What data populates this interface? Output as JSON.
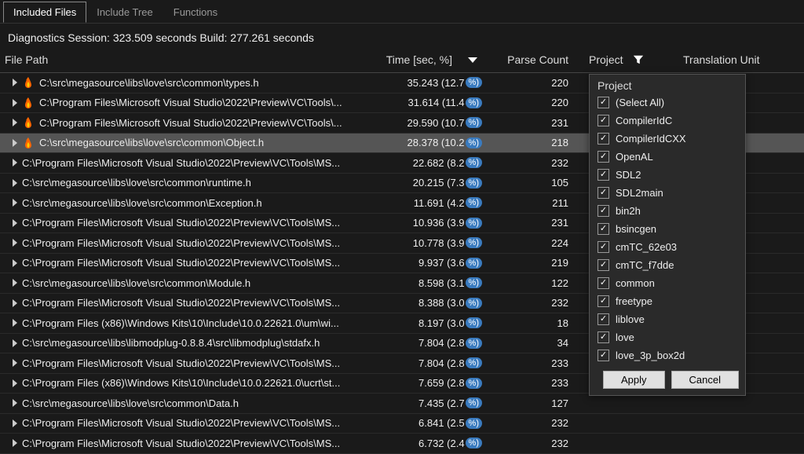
{
  "tabs": {
    "included_files": "Included Files",
    "include_tree": "Include Tree",
    "functions": "Functions"
  },
  "session_info": "Diagnostics Session: 323.509 seconds  Build: 277.261 seconds",
  "columns": {
    "file_path": "File Path",
    "time": "Time [sec, %]",
    "parse_count": "Parse Count",
    "project": "Project",
    "translation_unit": "Translation Unit"
  },
  "rows": [
    {
      "file": "C:\\src\\megasource\\libs\\love\\src\\common\\types.h",
      "time": "35.243 (12.7",
      "pct": "%)",
      "parse": "220",
      "hot": true
    },
    {
      "file": "C:\\Program Files\\Microsoft Visual Studio\\2022\\Preview\\VC\\Tools\\...",
      "time": "31.614 (11.4",
      "pct": "%)",
      "parse": "220",
      "hot": true
    },
    {
      "file": "C:\\Program Files\\Microsoft Visual Studio\\2022\\Preview\\VC\\Tools\\...",
      "time": "29.590 (10.7",
      "pct": "%)",
      "parse": "231",
      "hot": true
    },
    {
      "file": "C:\\src\\megasource\\libs\\love\\src\\common\\Object.h",
      "time": "28.378 (10.2",
      "pct": "%)",
      "parse": "218",
      "hot": true,
      "hover": true
    },
    {
      "file": "C:\\Program Files\\Microsoft Visual Studio\\2022\\Preview\\VC\\Tools\\MS...",
      "time": "22.682 (8.2",
      "pct": "%)",
      "parse": "232"
    },
    {
      "file": "C:\\src\\megasource\\libs\\love\\src\\common\\runtime.h",
      "time": "20.215 (7.3",
      "pct": "%)",
      "parse": "105"
    },
    {
      "file": "C:\\src\\megasource\\libs\\love\\src\\common\\Exception.h",
      "time": "11.691 (4.2",
      "pct": "%)",
      "parse": "211"
    },
    {
      "file": "C:\\Program Files\\Microsoft Visual Studio\\2022\\Preview\\VC\\Tools\\MS...",
      "time": "10.936 (3.9",
      "pct": "%)",
      "parse": "231"
    },
    {
      "file": "C:\\Program Files\\Microsoft Visual Studio\\2022\\Preview\\VC\\Tools\\MS...",
      "time": "10.778 (3.9",
      "pct": "%)",
      "parse": "224"
    },
    {
      "file": "C:\\Program Files\\Microsoft Visual Studio\\2022\\Preview\\VC\\Tools\\MS...",
      "time": "9.937 (3.6",
      "pct": "%)",
      "parse": "219"
    },
    {
      "file": "C:\\src\\megasource\\libs\\love\\src\\common\\Module.h",
      "time": "8.598 (3.1",
      "pct": "%)",
      "parse": "122"
    },
    {
      "file": "C:\\Program Files\\Microsoft Visual Studio\\2022\\Preview\\VC\\Tools\\MS...",
      "time": "8.388 (3.0",
      "pct": "%)",
      "parse": "232"
    },
    {
      "file": "C:\\Program Files (x86)\\Windows Kits\\10\\Include\\10.0.22621.0\\um\\wi...",
      "time": "8.197 (3.0",
      "pct": "%)",
      "parse": "18"
    },
    {
      "file": "C:\\src\\megasource\\libs\\libmodplug-0.8.8.4\\src\\libmodplug\\stdafx.h",
      "time": "7.804 (2.8",
      "pct": "%)",
      "parse": "34"
    },
    {
      "file": "C:\\Program Files\\Microsoft Visual Studio\\2022\\Preview\\VC\\Tools\\MS...",
      "time": "7.804 (2.8",
      "pct": "%)",
      "parse": "233"
    },
    {
      "file": "C:\\Program Files (x86)\\Windows Kits\\10\\Include\\10.0.22621.0\\ucrt\\st...",
      "time": "7.659 (2.8",
      "pct": "%)",
      "parse": "233"
    },
    {
      "file": "C:\\src\\megasource\\libs\\love\\src\\common\\Data.h",
      "time": "7.435 (2.7",
      "pct": "%)",
      "parse": "127"
    },
    {
      "file": "C:\\Program Files\\Microsoft Visual Studio\\2022\\Preview\\VC\\Tools\\MS...",
      "time": "6.841 (2.5",
      "pct": "%)",
      "parse": "232"
    },
    {
      "file": "C:\\Program Files\\Microsoft Visual Studio\\2022\\Preview\\VC\\Tools\\MS...",
      "time": "6.732 (2.4",
      "pct": "%)",
      "parse": "232"
    }
  ],
  "filter": {
    "title": "Project",
    "options": [
      "(Select All)",
      "CompilerIdC",
      "CompilerIdCXX",
      "OpenAL",
      "SDL2",
      "SDL2main",
      "bin2h",
      "bsincgen",
      "cmTC_62e03",
      "cmTC_f7dde",
      "common",
      "freetype",
      "liblove",
      "love",
      "love_3p_box2d"
    ],
    "apply": "Apply",
    "cancel": "Cancel"
  }
}
